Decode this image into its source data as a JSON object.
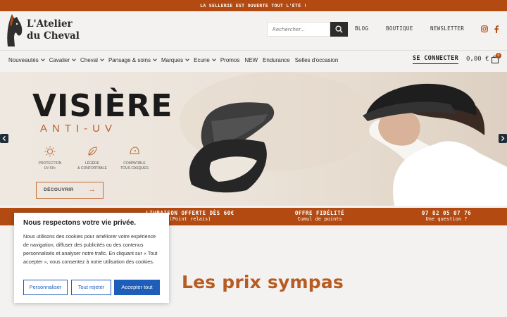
{
  "announcement": "LA SELLERIE EST OUVERTE TOUT L'ÉTÉ !",
  "brand": {
    "line1": "L'Atelier",
    "line2": "du Cheval"
  },
  "search": {
    "placeholder": "Rechercher..."
  },
  "header_nav": [
    "BLOG",
    "BOUTIQUE",
    "NEWSLETTER"
  ],
  "social": [
    "instagram-icon",
    "facebook-icon"
  ],
  "menu": [
    {
      "label": "Nouveautés",
      "dropdown": true
    },
    {
      "label": "Cavalier",
      "dropdown": true
    },
    {
      "label": "Cheval",
      "dropdown": true
    },
    {
      "label": "Pansage & soins",
      "dropdown": true
    },
    {
      "label": "Marques",
      "dropdown": true
    },
    {
      "label": "Ecurie",
      "dropdown": true
    },
    {
      "label": "Promos",
      "dropdown": false
    },
    {
      "label": "NEW",
      "dropdown": false
    },
    {
      "label": "Endurance",
      "dropdown": false
    },
    {
      "label": "Selles d'occasion",
      "dropdown": false
    }
  ],
  "account": {
    "login": "SE CONNECTER",
    "cart_total": "0,00 €",
    "cart_count": "0"
  },
  "hero": {
    "title": "VISIÈRE",
    "subtitle": "ANTI-UV",
    "features": [
      {
        "icon": "sun-icon",
        "line1": "PROTECTION",
        "line2": "UV 50+"
      },
      {
        "icon": "leaf-icon",
        "line1": "LÉGÈRE",
        "line2": "& CONFORTABLE"
      },
      {
        "icon": "helmet-icon",
        "line1": "COMPATIBLE",
        "line2": "TOUS CASQUES"
      }
    ],
    "cta": "DÉCOUVRIR"
  },
  "benefits": [
    {
      "title": "LIVRAISON OFFERTE DÈS 60€",
      "sub": "(Point relais)"
    },
    {
      "title": "OFFRE FIDÉLITÉ",
      "sub": "Cumul de points"
    },
    {
      "title": "07 82 05 07 76",
      "sub": "Une question ?"
    }
  ],
  "section_title": "Les prix sympas",
  "cookie": {
    "title": "Nous respectons votre vie privée.",
    "text": "Nous utilisons des cookies pour améliorer votre expérience de navigation, diffuser des publicités ou des contenus personnalisés et analyser notre trafic. En cliquant sur « Tout accepter », vous consentez à notre utilisation des cookies.",
    "btn_customize": "Personnaliser",
    "btn_reject": "Tout rejeter",
    "btn_accept": "Accepter tout"
  },
  "colors": {
    "brand": "#b24a12",
    "accent_text": "#b85b22",
    "cookie_button": "#1f5eb8",
    "dark": "#2c2c2c"
  }
}
